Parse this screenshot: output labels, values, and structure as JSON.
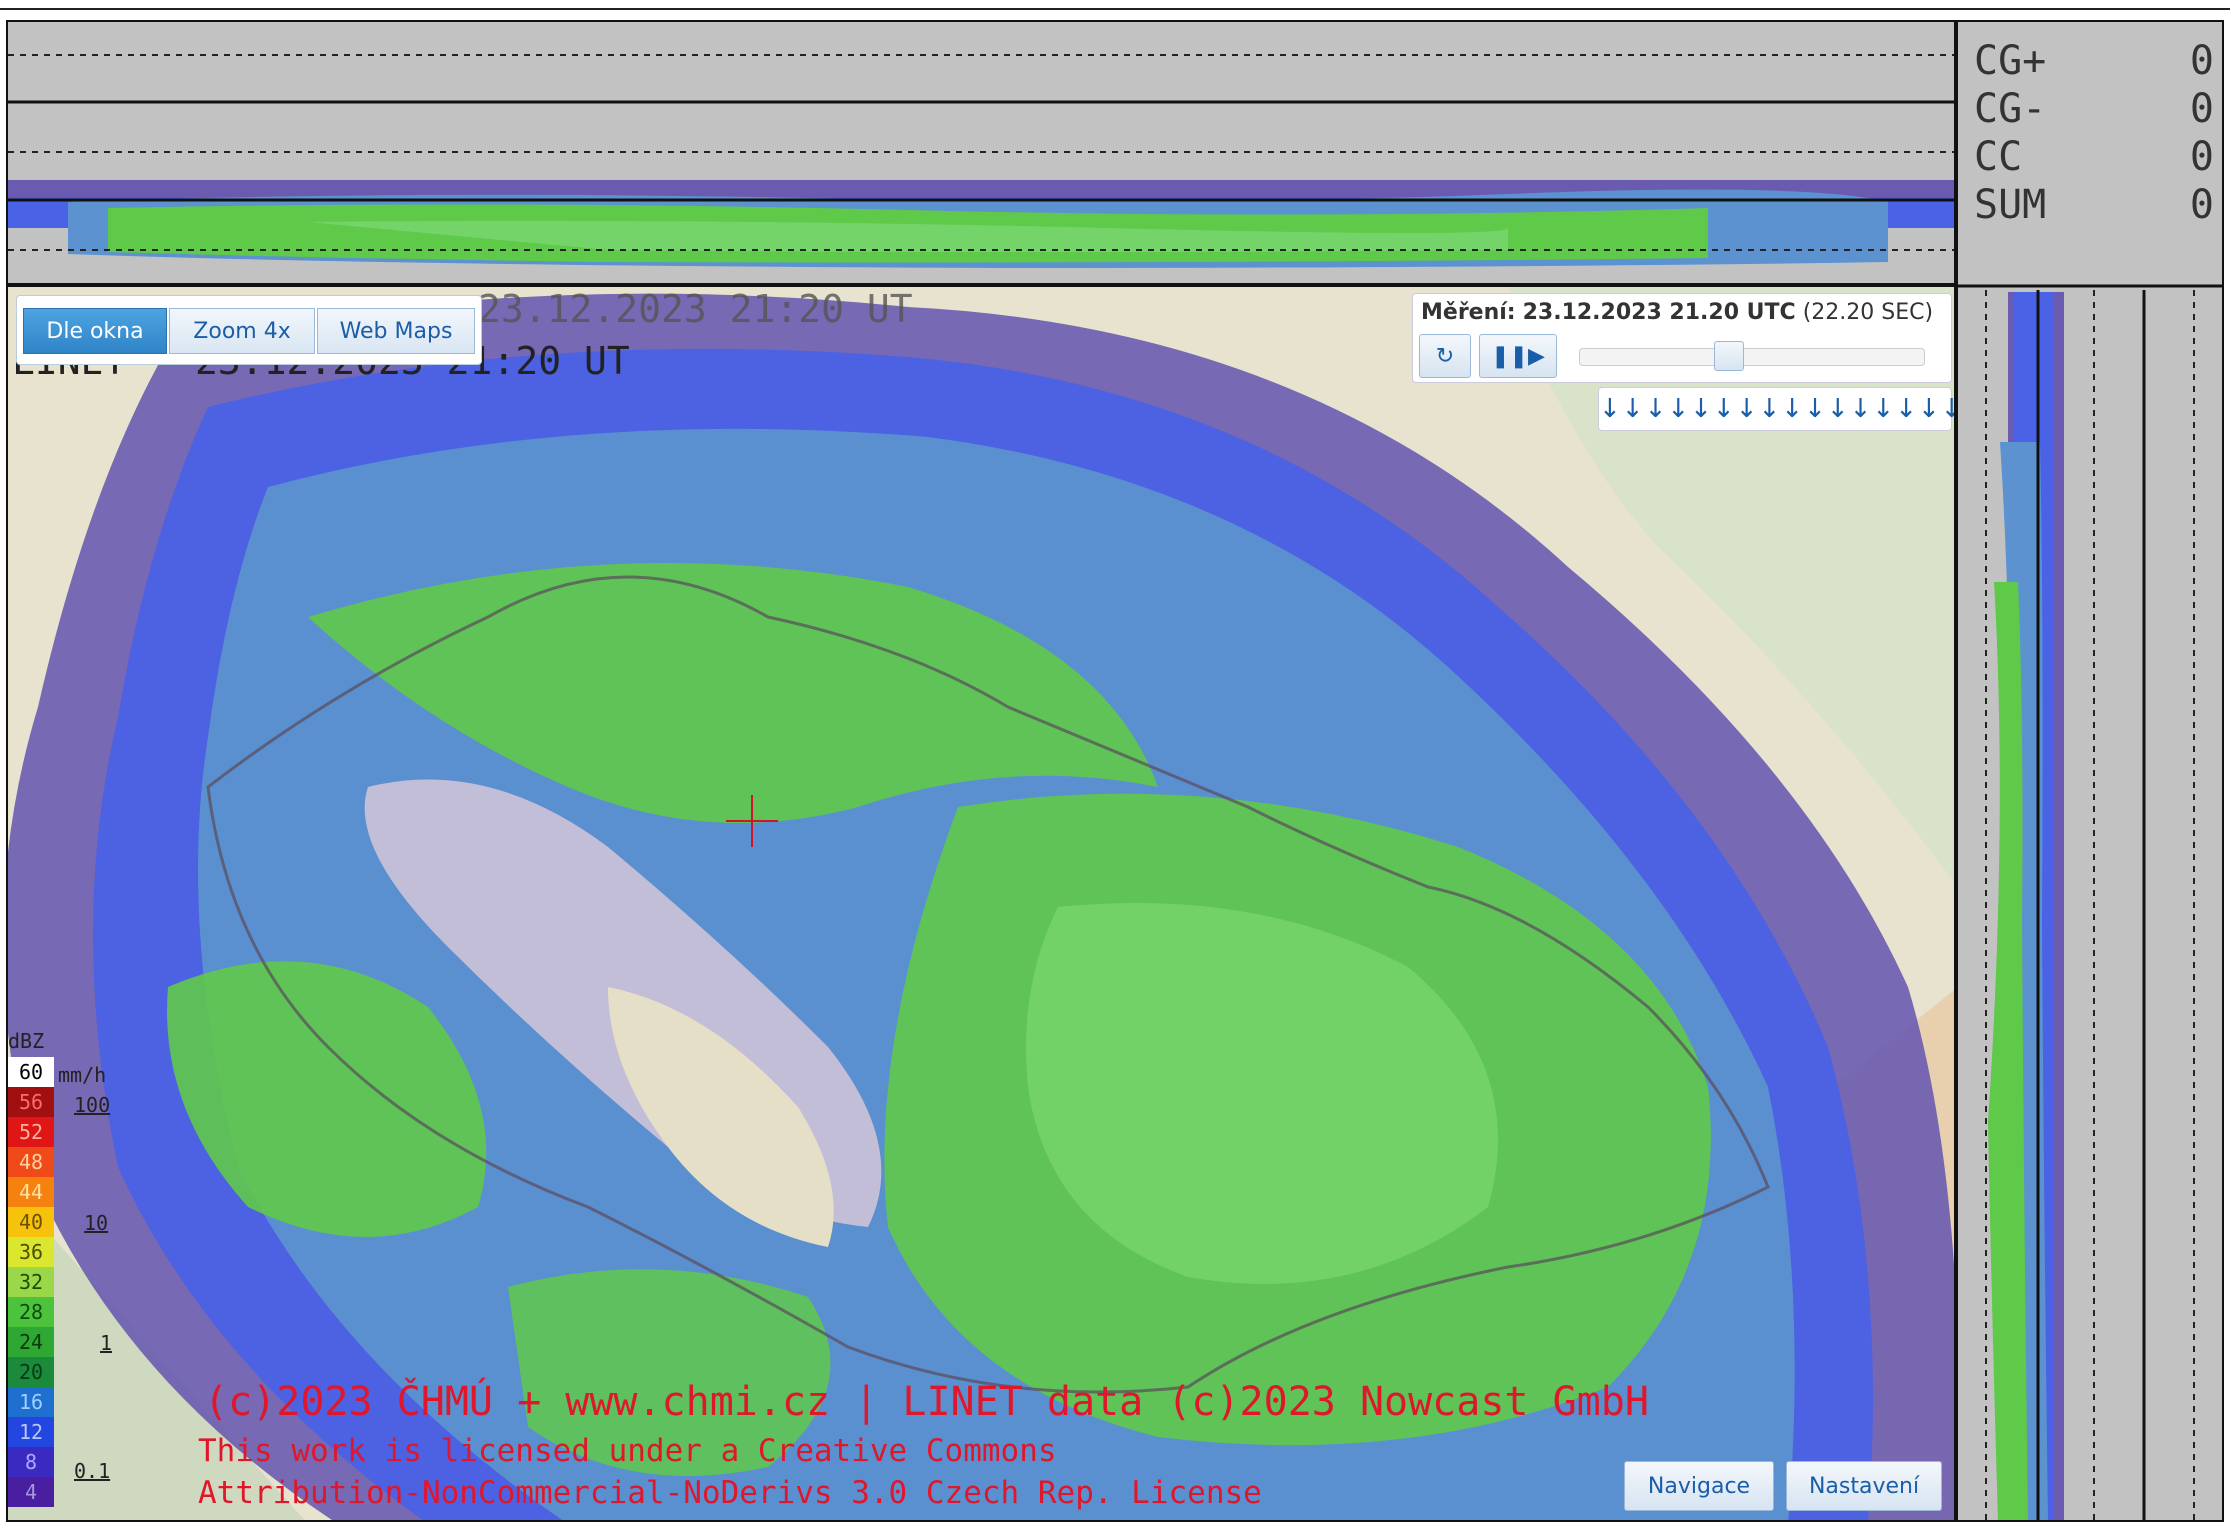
{
  "header_overlay": {
    "linet_time": "LINET - 23.12.2023 21:20 UT",
    "ghost_time": "23.12.2023 21:20 UT"
  },
  "counters": [
    {
      "label": "CG+",
      "value": "0"
    },
    {
      "label": "CG-",
      "value": "0"
    },
    {
      "label": "CC",
      "value": "0"
    },
    {
      "label": "SUM",
      "value": "0"
    }
  ],
  "view_tabs": [
    {
      "label": "Dle okna",
      "active": true
    },
    {
      "label": "Zoom 4x",
      "active": false
    },
    {
      "label": "Web Maps",
      "active": false
    }
  ],
  "measurement": {
    "prefix": "Měření:",
    "datetime": "23.12.2023 21.20 UTC",
    "interval": "(22.20 SEC)",
    "refresh_icon": "refresh-icon",
    "playpause_icon": "pause-play-icon",
    "slider_fraction": 0.43,
    "arrows": "↓↓↓↓↓↓↓↓↓↓↓↓↓↓↓↓↓↓↓"
  },
  "legend": {
    "dbz_label": "dBZ",
    "mmh_label": "mm/h",
    "levels": [
      {
        "dbz": "60",
        "color": "#ffffff",
        "text": "#000000"
      },
      {
        "dbz": "56",
        "color": "#a01010",
        "text": "#ff6a6a"
      },
      {
        "dbz": "52",
        "color": "#e01515",
        "text": "#ffb0a0"
      },
      {
        "dbz": "48",
        "color": "#f04a18",
        "text": "#ffd0a0"
      },
      {
        "dbz": "44",
        "color": "#f5820f",
        "text": "#ffe0a0"
      },
      {
        "dbz": "40",
        "color": "#f6c20c",
        "text": "#6a5000"
      },
      {
        "dbz": "36",
        "color": "#dbe62e",
        "text": "#4a5000"
      },
      {
        "dbz": "32",
        "color": "#9ad84a",
        "text": "#244a00"
      },
      {
        "dbz": "28",
        "color": "#4cc33c",
        "text": "#0f4a0f"
      },
      {
        "dbz": "24",
        "color": "#2ea832",
        "text": "#0a3a0a"
      },
      {
        "dbz": "20",
        "color": "#1b8a3a",
        "text": "#063a18"
      },
      {
        "dbz": "16",
        "color": "#1f6fd0",
        "text": "#a0d0ff"
      },
      {
        "dbz": "12",
        "color": "#2446e0",
        "text": "#b8c8ff"
      },
      {
        "dbz": "8",
        "color": "#3a2ac0",
        "text": "#b0a8ff"
      },
      {
        "dbz": "4",
        "color": "#4a1ea0",
        "text": "#a098e0"
      }
    ],
    "rain_rates": [
      "100",
      "10",
      "1",
      "0.1"
    ]
  },
  "copyright": {
    "line1": "(c)2023 ČHMÚ + www.chmi.cz | LINET data (c)2023 Nowcast GmbH",
    "line2": "This work is licensed under a Creative Commons",
    "line3": "Attribution-NonCommercial-NoDerivs 3.0 Czech Rep. License"
  },
  "bottom_buttons": {
    "navigation": "Navigace",
    "settings": "Nastavení"
  },
  "colors": {
    "panel_bg": "#c2c2c2",
    "purple": "#6a5bb0",
    "blue": "#4a62e6",
    "teal": "#5b92cf",
    "green": "#5fc94a",
    "copyright_red": "#e0162b"
  }
}
